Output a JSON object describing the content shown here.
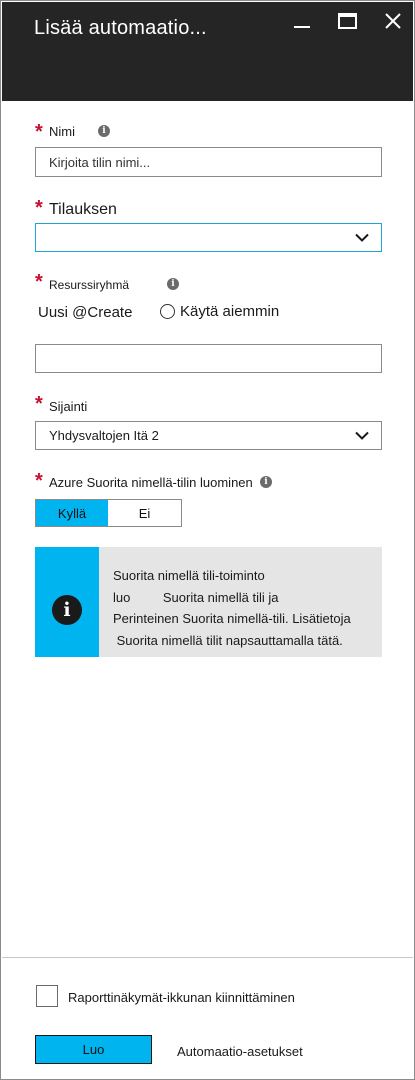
{
  "window": {
    "title": "Lisää automaatio...",
    "minimize_icon": "minimize-icon",
    "maximize_icon": "maximize-icon",
    "close_icon": "close-icon"
  },
  "form": {
    "name": {
      "label": "Nimi",
      "placeholder": "Kirjoita tilin nimi...",
      "value": ""
    },
    "subscription": {
      "label": "Tilauksen",
      "value": ""
    },
    "resource_group": {
      "label": "Resurssiryhmä",
      "option_new": "Uusi @Create",
      "option_existing": "Käytä aiemmin",
      "value": ""
    },
    "location": {
      "label": "Sijainti",
      "value": "Yhdysvaltojen Itä 2"
    },
    "run_as": {
      "label": "Azure Suorita nimellä-tilin luominen",
      "yes": "Kyllä",
      "no": "Ei",
      "selected": "Kyllä"
    }
  },
  "info_box": {
    "lines": [
      "Suorita nimellä tili-toiminto",
      "luo         Suorita nimellä tili ja",
      "Perinteinen Suorita nimellä-tili. Lisätietoja",
      " Suorita nimellä tilit napsauttamalla tätä."
    ]
  },
  "footer": {
    "pin_label": "Raporttinäkymät-ikkunan kiinnittäminen",
    "pin_checked": false,
    "create_label": "Luo",
    "settings_label": "Automaatio-asetukset"
  },
  "colors": {
    "accent": "#00b4f0",
    "titlebar": "#252525",
    "required": "#c8102e",
    "focus_border": "#1fa3d8"
  }
}
